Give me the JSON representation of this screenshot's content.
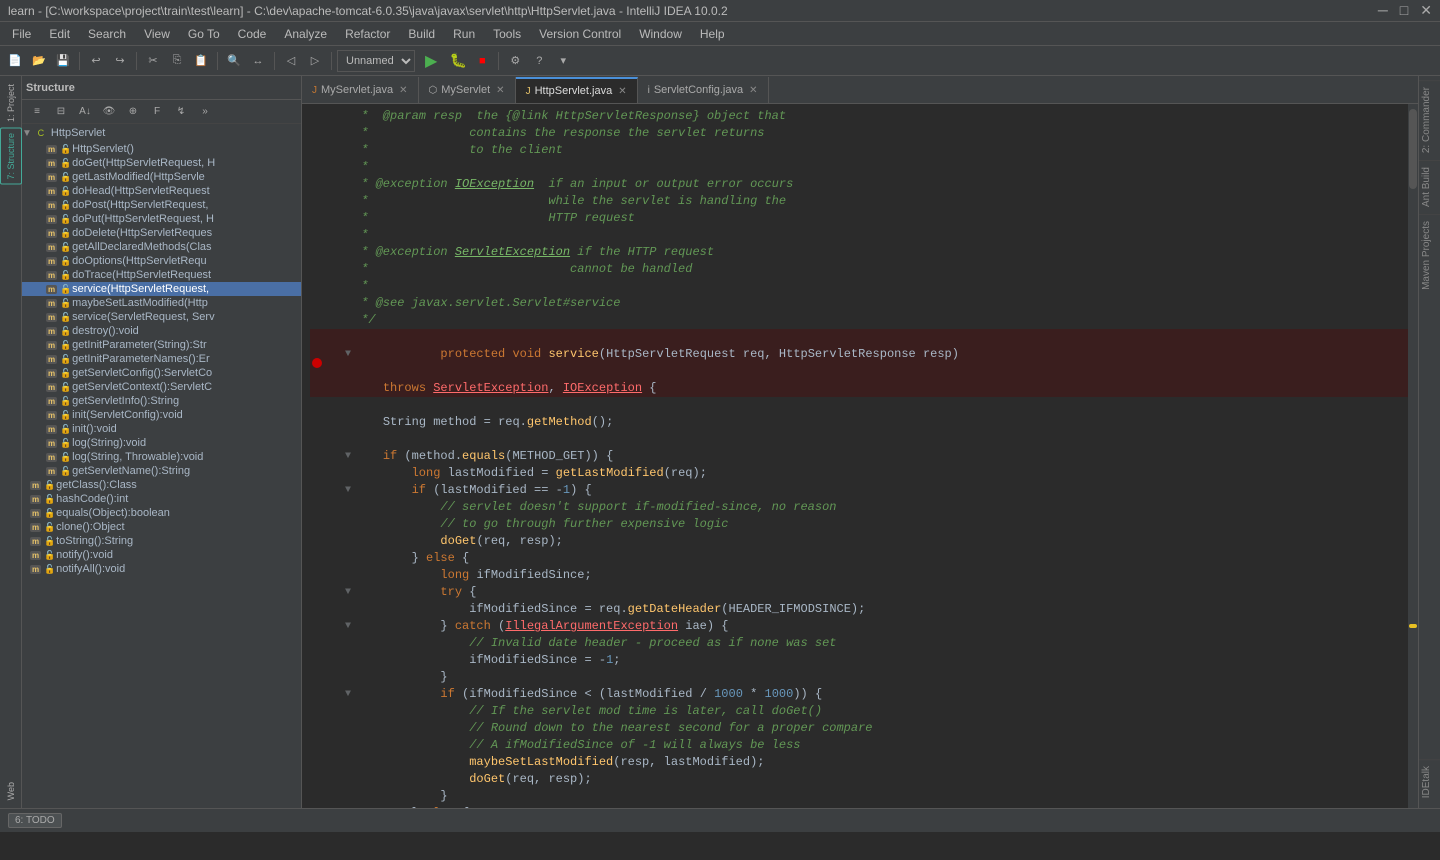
{
  "titlebar": {
    "title": "learn - [C:\\workspace\\project\\train\\test\\learn] - C:\\dev\\apache-tomcat-6.0.35\\java\\javax\\servlet\\http\\HttpServlet.java - IntelliJ IDEA 10.0.2"
  },
  "menubar": {
    "items": [
      "File",
      "Edit",
      "Search",
      "View",
      "Go To",
      "Code",
      "Analyze",
      "Refactor",
      "Build",
      "Run",
      "Tools",
      "Version Control",
      "Window",
      "Help"
    ]
  },
  "tabs": [
    {
      "label": "MyServlet.java",
      "type": "java",
      "active": false
    },
    {
      "label": "MyServlet",
      "type": "class",
      "active": false
    },
    {
      "label": "HttpServlet.java",
      "type": "java",
      "active": true
    },
    {
      "label": "ServletConfig.java",
      "type": "interface",
      "active": false
    }
  ],
  "structure": {
    "header": "Structure",
    "root": "HttpServlet",
    "items": [
      {
        "label": "HttpServlet()",
        "type": "m",
        "indent": 1
      },
      {
        "label": "doGet(HttpServletRequest, H",
        "type": "m",
        "indent": 1
      },
      {
        "label": "getLastModified(HttpServle",
        "type": "m",
        "indent": 1
      },
      {
        "label": "doHead(HttpServletRequest",
        "type": "m",
        "indent": 1
      },
      {
        "label": "doPost(HttpServletRequest,",
        "type": "m",
        "indent": 1
      },
      {
        "label": "doPut(HttpServletRequest, H",
        "type": "m",
        "indent": 1
      },
      {
        "label": "doDelete(HttpServletReques",
        "type": "m",
        "indent": 1
      },
      {
        "label": "getAllDeclaredMethods(Clas",
        "type": "m",
        "indent": 1
      },
      {
        "label": "doOptions(HttpServletRequ",
        "type": "m",
        "indent": 1
      },
      {
        "label": "doTrace(HttpServletRequest",
        "type": "m",
        "indent": 1
      },
      {
        "label": "service(HttpServletRequest,",
        "type": "m",
        "indent": 1,
        "selected": true
      },
      {
        "label": "maybeSetLastModified(Http",
        "type": "m",
        "indent": 1
      },
      {
        "label": "service(ServletRequest, Serv",
        "type": "m",
        "indent": 1
      },
      {
        "label": "destroy():void",
        "type": "m",
        "indent": 1
      },
      {
        "label": "getInitParameter(String):Str",
        "type": "m",
        "indent": 1
      },
      {
        "label": "getInitParameterNames():Er",
        "type": "m",
        "indent": 1
      },
      {
        "label": "getServletConfig():ServletCo",
        "type": "m",
        "indent": 1
      },
      {
        "label": "getServletContext():ServletC",
        "type": "m",
        "indent": 1
      },
      {
        "label": "getServletInfo():String",
        "type": "m",
        "indent": 1
      },
      {
        "label": "init(ServletConfig):void",
        "type": "m",
        "indent": 1
      },
      {
        "label": "init():void",
        "type": "m",
        "indent": 1
      },
      {
        "label": "log(String):void",
        "type": "m",
        "indent": 1
      },
      {
        "label": "log(String, Throwable):void",
        "type": "m",
        "indent": 1
      },
      {
        "label": "getServletName():String",
        "type": "m",
        "indent": 1
      },
      {
        "label": "getClass():Class<?>",
        "type": "m",
        "indent": 0
      },
      {
        "label": "hashCode():int",
        "type": "m",
        "indent": 0
      },
      {
        "label": "equals(Object):boolean",
        "type": "m",
        "indent": 0
      },
      {
        "label": "clone():Object",
        "type": "m",
        "indent": 0
      },
      {
        "label": "toString():String",
        "type": "m",
        "indent": 0
      },
      {
        "label": "notify():void",
        "type": "m",
        "indent": 0
      },
      {
        "label": "notifyAll():void",
        "type": "m",
        "indent": 0
      }
    ]
  },
  "code": {
    "lines": [
      {
        "content": " *  @param resp  the {@link HttpServletResponse} object that",
        "type": "comment"
      },
      {
        "content": " *              contains the response the servlet returns",
        "type": "comment"
      },
      {
        "content": " *              to the client",
        "type": "comment"
      },
      {
        "content": " *",
        "type": "comment"
      },
      {
        "content": " * @exception IOException  if an input or output error occurs",
        "type": "comment"
      },
      {
        "content": " *                         while the servlet is handling the",
        "type": "comment"
      },
      {
        "content": " *                         HTTP request",
        "type": "comment"
      },
      {
        "content": " *",
        "type": "comment"
      },
      {
        "content": " * @exception ServletException if the HTTP request",
        "type": "comment"
      },
      {
        "content": " *                            cannot be handled",
        "type": "comment"
      },
      {
        "content": " *",
        "type": "comment"
      },
      {
        "content": " * @see javax.servlet.Servlet#service",
        "type": "comment"
      },
      {
        "content": " */",
        "type": "comment"
      },
      {
        "content": "protected void service(HttpServletRequest req, HttpServletResponse resp)",
        "type": "code",
        "breakpoint": true
      },
      {
        "content": "    throws ServletException, IOException {",
        "type": "code"
      },
      {
        "content": "",
        "type": "code"
      },
      {
        "content": "    String method = req.getMethod();",
        "type": "code"
      },
      {
        "content": "",
        "type": "code"
      },
      {
        "content": "    if (method.equals(METHOD_GET)) {",
        "type": "code"
      },
      {
        "content": "        long lastModified = getLastModified(req);",
        "type": "code"
      },
      {
        "content": "        if (lastModified == -1) {",
        "type": "code"
      },
      {
        "content": "            // servlet doesn't support if-modified-since, no reason",
        "type": "comment2"
      },
      {
        "content": "            // to go through further expensive logic",
        "type": "comment2"
      },
      {
        "content": "            doGet(req, resp);",
        "type": "code"
      },
      {
        "content": "        } else {",
        "type": "code"
      },
      {
        "content": "            long ifModifiedSince;",
        "type": "code"
      },
      {
        "content": "            try {",
        "type": "code"
      },
      {
        "content": "                ifModifiedSince = req.getDateHeader(HEADER_IFMODSINCE);",
        "type": "code"
      },
      {
        "content": "            } catch (IllegalArgumentException iae) {",
        "type": "code"
      },
      {
        "content": "                // Invalid date header - proceed as if none was set",
        "type": "comment2"
      },
      {
        "content": "                ifModifiedSince = -1;",
        "type": "code"
      },
      {
        "content": "            }",
        "type": "code"
      },
      {
        "content": "            if (ifModifiedSince < (lastModified / 1000 * 1000)) {",
        "type": "code"
      },
      {
        "content": "                // If the servlet mod time is later, call doGet()",
        "type": "comment2"
      },
      {
        "content": "                // Round down to the nearest second for a proper compare",
        "type": "comment2"
      },
      {
        "content": "                // A ifModifiedSince of -1 will always be less",
        "type": "comment2"
      },
      {
        "content": "                maybeSetLastModified(resp, lastModified);",
        "type": "code"
      },
      {
        "content": "                doGet(req, resp);",
        "type": "code"
      },
      {
        "content": "            }",
        "type": "code"
      },
      {
        "content": "        } else {",
        "type": "code"
      }
    ]
  },
  "bottom": {
    "todo_label": "6: TODO"
  },
  "right_tabs": [
    "2: Commander",
    "Ant Build",
    "Maven Projects",
    "IDEtalk"
  ],
  "toolbar_run": "Unnamed ▼"
}
